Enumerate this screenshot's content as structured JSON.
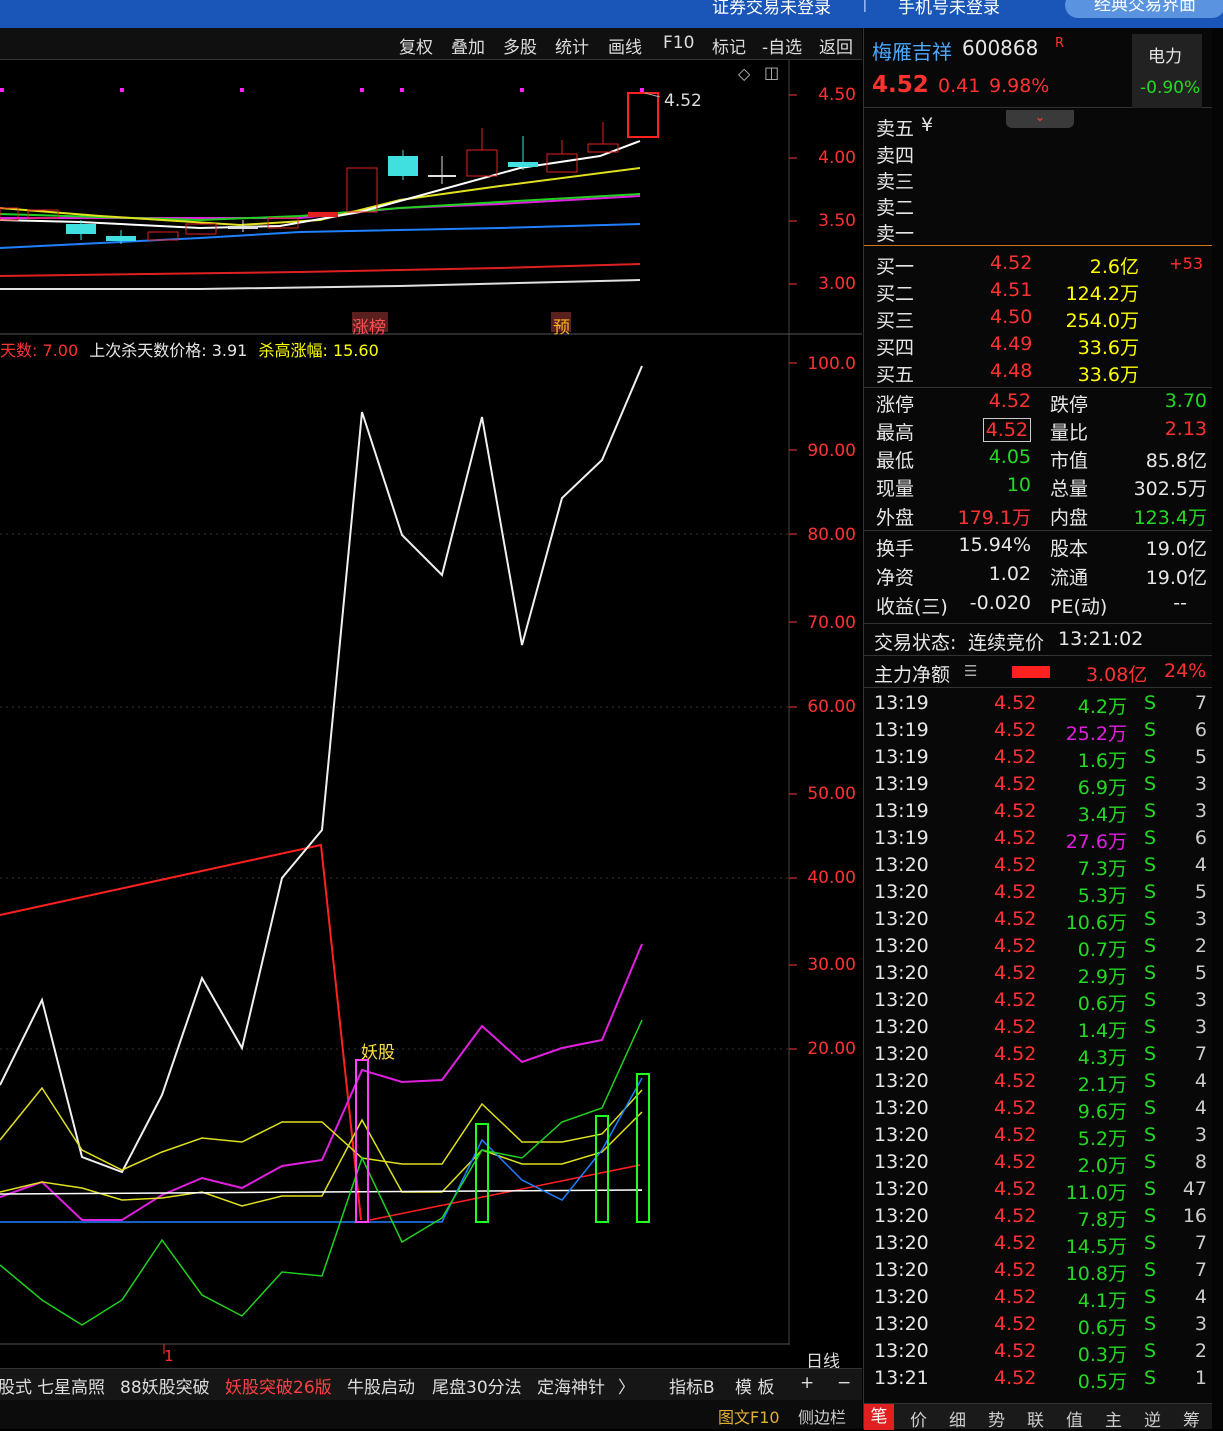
{
  "topbar": {
    "securities_login": "证券交易未登录",
    "phone_login": "手机号未登录",
    "classic_trade": "经典交易界面"
  },
  "toolbar": [
    "复权",
    "叠加",
    "多股",
    "统计",
    "画线",
    "F10",
    "标记",
    "-自选",
    "返回"
  ],
  "price_chart": {
    "last_label": "4.52",
    "ticks": [
      "4.50",
      "4.00",
      "3.50",
      "3.00"
    ],
    "markers": {
      "zhangbang": "涨榜",
      "yu": "预"
    }
  },
  "indicator": {
    "info_days_label": "天数:",
    "info_days_value": "7.00",
    "info_last_kill_label": "上次杀天数价格:",
    "info_last_kill_value": "3.91",
    "info_kill_high_label": "杀高涨幅:",
    "info_kill_high_value": "15.60",
    "ticks": [
      "100.0",
      "90.00",
      "80.00",
      "70.00",
      "60.00",
      "50.00",
      "40.00",
      "30.00",
      "20.00"
    ],
    "yaogu_label": "妖股",
    "period": "日线",
    "marker_1": "1"
  },
  "bottom_tabs": [
    "股式",
    "七星高照",
    "88妖股突破",
    "妖股突破26版",
    "牛股启动",
    "尾盘30分法",
    "定海神针",
    "〉"
  ],
  "bottom_right": {
    "zhibiao": "指标B",
    "moban": "模 板",
    "plus": "+",
    "minus": "−"
  },
  "footer": {
    "f10": "图文F10",
    "sidebar": "侧边栏"
  },
  "stock": {
    "name": "梅雁吉祥",
    "code": "600868",
    "flag": "R",
    "price": "4.52",
    "change": "0.41",
    "pct": "9.98%",
    "sector": "电力",
    "sector_pct": "-0.90%"
  },
  "asks": [
    {
      "label": "卖五",
      "extra": "¥"
    },
    {
      "label": "卖四"
    },
    {
      "label": "卖三"
    },
    {
      "label": "卖二"
    },
    {
      "label": "卖一"
    }
  ],
  "bids": [
    {
      "label": "买一",
      "price": "4.52",
      "vol": "2.6亿",
      "chg": "+53"
    },
    {
      "label": "买二",
      "price": "4.51",
      "vol": "124.2万"
    },
    {
      "label": "买三",
      "price": "4.50",
      "vol": "254.0万"
    },
    {
      "label": "买四",
      "price": "4.49",
      "vol": "33.6万"
    },
    {
      "label": "买五",
      "price": "4.48",
      "vol": "33.6万"
    }
  ],
  "stats": [
    {
      "l1": "涨停",
      "v1": "4.52",
      "c1": "red",
      "l2": "跌停",
      "v2": "3.70",
      "c2": "green"
    },
    {
      "l1": "最高",
      "v1": "4.52",
      "c1": "red",
      "l2": "量比",
      "v2": "2.13",
      "c2": "red"
    },
    {
      "l1": "最低",
      "v1": "4.05",
      "c1": "green",
      "l2": "市值",
      "v2": "85.8亿",
      "c2": "white"
    },
    {
      "l1": "现量",
      "v1": "10",
      "c1": "green",
      "l2": "总量",
      "v2": "302.5万",
      "c2": "white"
    },
    {
      "l1": "外盘",
      "v1": "179.1万",
      "c1": "red",
      "l2": "内盘",
      "v2": "123.4万",
      "c2": "green"
    },
    {
      "l1": "换手",
      "v1": "15.94%",
      "c1": "white",
      "l2": "股本",
      "v2": "19.0亿",
      "c2": "white"
    },
    {
      "l1": "净资",
      "v1": "1.02",
      "c1": "white",
      "l2": "流通",
      "v2": "19.0亿",
      "c2": "white"
    },
    {
      "l1": "收益(三)",
      "v1": "-0.020",
      "c1": "white",
      "l2": "PE(动)",
      "v2": "--",
      "c2": "white"
    }
  ],
  "status": {
    "label": "交易状态:",
    "state": "连续竞价",
    "time": "13:21:02"
  },
  "main_force": {
    "label": "主力净额",
    "value": "3.08亿",
    "pct": "24%"
  },
  "ticks": [
    {
      "t": "13:19",
      "p": "4.52",
      "v": "4.2万",
      "d": "S",
      "n": "7",
      "c": "green"
    },
    {
      "t": "13:19",
      "p": "4.52",
      "v": "25.2万",
      "d": "S",
      "n": "6",
      "c": "magenta"
    },
    {
      "t": "13:19",
      "p": "4.52",
      "v": "1.6万",
      "d": "S",
      "n": "5",
      "c": "green"
    },
    {
      "t": "13:19",
      "p": "4.52",
      "v": "6.9万",
      "d": "S",
      "n": "3",
      "c": "green"
    },
    {
      "t": "13:19",
      "p": "4.52",
      "v": "3.4万",
      "d": "S",
      "n": "3",
      "c": "green"
    },
    {
      "t": "13:19",
      "p": "4.52",
      "v": "27.6万",
      "d": "S",
      "n": "6",
      "c": "magenta"
    },
    {
      "t": "13:20",
      "p": "4.52",
      "v": "7.3万",
      "d": "S",
      "n": "4",
      "c": "green"
    },
    {
      "t": "13:20",
      "p": "4.52",
      "v": "5.3万",
      "d": "S",
      "n": "5",
      "c": "green"
    },
    {
      "t": "13:20",
      "p": "4.52",
      "v": "10.6万",
      "d": "S",
      "n": "3",
      "c": "green"
    },
    {
      "t": "13:20",
      "p": "4.52",
      "v": "0.7万",
      "d": "S",
      "n": "2",
      "c": "green"
    },
    {
      "t": "13:20",
      "p": "4.52",
      "v": "2.9万",
      "d": "S",
      "n": "5",
      "c": "green"
    },
    {
      "t": "13:20",
      "p": "4.52",
      "v": "0.6万",
      "d": "S",
      "n": "3",
      "c": "green"
    },
    {
      "t": "13:20",
      "p": "4.52",
      "v": "1.4万",
      "d": "S",
      "n": "3",
      "c": "green"
    },
    {
      "t": "13:20",
      "p": "4.52",
      "v": "4.3万",
      "d": "S",
      "n": "7",
      "c": "green"
    },
    {
      "t": "13:20",
      "p": "4.52",
      "v": "2.1万",
      "d": "S",
      "n": "4",
      "c": "green"
    },
    {
      "t": "13:20",
      "p": "4.52",
      "v": "9.6万",
      "d": "S",
      "n": "4",
      "c": "green"
    },
    {
      "t": "13:20",
      "p": "4.52",
      "v": "5.2万",
      "d": "S",
      "n": "3",
      "c": "green"
    },
    {
      "t": "13:20",
      "p": "4.52",
      "v": "2.0万",
      "d": "S",
      "n": "8",
      "c": "green"
    },
    {
      "t": "13:20",
      "p": "4.52",
      "v": "11.0万",
      "d": "S",
      "n": "47",
      "c": "green"
    },
    {
      "t": "13:20",
      "p": "4.52",
      "v": "7.8万",
      "d": "S",
      "n": "16",
      "c": "green"
    },
    {
      "t": "13:20",
      "p": "4.52",
      "v": "14.5万",
      "d": "S",
      "n": "7",
      "c": "green"
    },
    {
      "t": "13:20",
      "p": "4.52",
      "v": "10.8万",
      "d": "S",
      "n": "7",
      "c": "green"
    },
    {
      "t": "13:20",
      "p": "4.52",
      "v": "4.1万",
      "d": "S",
      "n": "4",
      "c": "green"
    },
    {
      "t": "13:20",
      "p": "4.52",
      "v": "0.6万",
      "d": "S",
      "n": "3",
      "c": "green"
    },
    {
      "t": "13:20",
      "p": "4.52",
      "v": "0.3万",
      "d": "S",
      "n": "2",
      "c": "green"
    },
    {
      "t": "13:21",
      "p": "4.52",
      "v": "0.5万",
      "d": "S",
      "n": "1",
      "c": "green"
    }
  ],
  "right_tabs": [
    "笔",
    "价",
    "细",
    "势",
    "联",
    "值",
    "主",
    "逆",
    "筹"
  ]
}
